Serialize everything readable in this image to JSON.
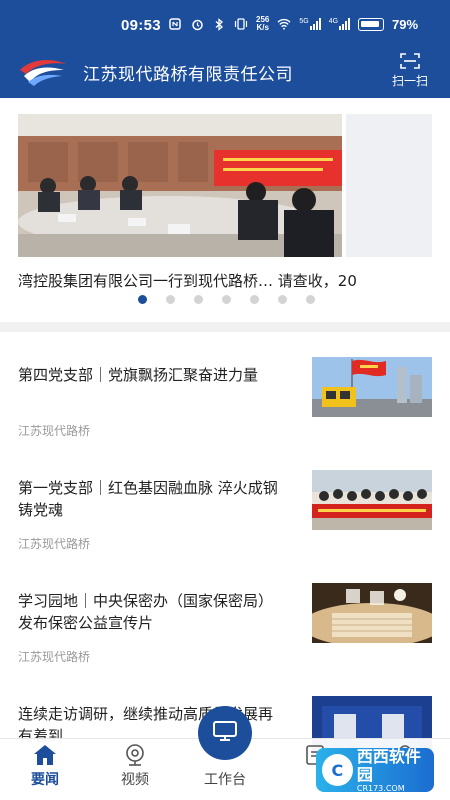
{
  "status_bar": {
    "time": "09:53",
    "net_speed_top": "256",
    "net_speed_bottom": "K/s",
    "net_5g": "5G",
    "net_4g": "4G",
    "battery": "79%"
  },
  "app_bar": {
    "title": "江苏现代路桥有限责任公司",
    "scan_label": "扫一扫",
    "brand_color": "#1c4e9c"
  },
  "carousel": {
    "caption": "湾控股集团有限公司一行到现代路桥…  请查收，20",
    "dot_count": 7,
    "active_index": 0
  },
  "news": [
    {
      "title": "第四党支部｜党旗飘扬汇聚奋进力量",
      "source": "江苏现代路桥"
    },
    {
      "title": "第一党支部｜红色基因融血脉  淬火成钢铸党魂",
      "source": "江苏现代路桥"
    },
    {
      "title": "学习园地｜中央保密办（国家保密局）发布保密公益宣传片",
      "source": "江苏现代路桥"
    },
    {
      "title": "连续走访调研，继续推动高质量发展再有着到",
      "source": ""
    }
  ],
  "bottom_nav": {
    "items": [
      {
        "label": "要闻",
        "icon": "home-icon",
        "active": true
      },
      {
        "label": "视频",
        "icon": "video-camera-icon",
        "active": false
      },
      {
        "label": "工作台",
        "icon": "monitor-icon",
        "active": false
      },
      {
        "label": "",
        "icon": "grid-icon",
        "active": false
      },
      {
        "label": "",
        "icon": "user-icon",
        "active": false
      }
    ]
  },
  "watermark": {
    "text": "西西软件园",
    "sub": "CR173.COM"
  }
}
